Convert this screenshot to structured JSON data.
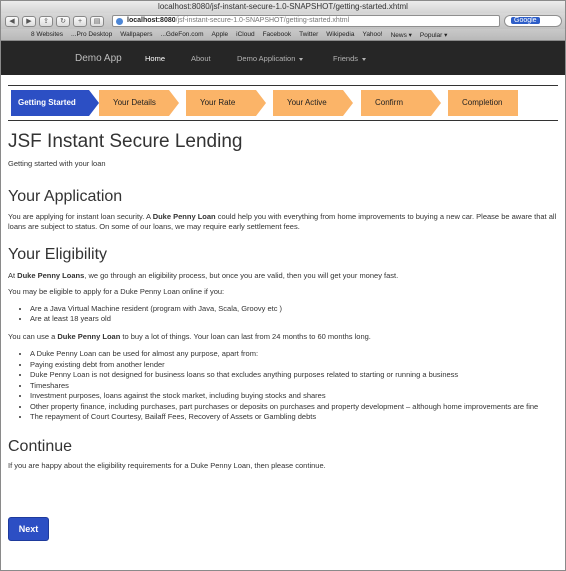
{
  "browser": {
    "title": "localhost:8080/jsf-instant-secure-1.0-SNAPSHOT/getting-started.xhtml",
    "url_host": "localhost:8080",
    "url_path": "/jsf-instant-secure-1.0-SNAPSHOT/getting-started.xhtml",
    "search_value": "Google",
    "bookmarks": [
      "8 Websites",
      "...Pro Desktop",
      "Wallpapers",
      "...GdeFon.com",
      "Apple",
      "iCloud",
      "Facebook",
      "Twitter",
      "Wikipedia",
      "Yahoo!",
      "News ▾",
      "Popular ▾"
    ]
  },
  "navbar": {
    "brand": "Demo App",
    "links": [
      "Home",
      "About",
      "Demo Application",
      "Friends"
    ]
  },
  "steps": [
    "Getting Started",
    "Your Details",
    "Your Rate",
    "Your Active",
    "Confirm",
    "Completion"
  ],
  "page": {
    "title": "JSF Instant Secure Lending",
    "subtitle": "Getting started with your loan",
    "application_heading": "Your Application",
    "application_p1": "You are applying for instant loan security. A ",
    "application_p1_bold": "Duke Penny Loan",
    "application_p1_rest": " could help you with everything from home improvements to buying a new car. Please be aware that all loans are subject to status. On some of our loans, we may require early settlement fees.",
    "eligibility_heading": "Your Eligibility",
    "elig_p1_pre": "At ",
    "elig_p1_bold": "Duke Penny Loans",
    "elig_p1_rest": ", we go through an eligibility process, but once you are valid, then you will get your money fast.",
    "elig_p2": "You may be eligible to apply for a Duke Penny Loan online if you:",
    "elig_list": [
      "Are a Java Virtual Machine resident (program with Java, Scala, Groovy etc )",
      "Are at least 18 years old"
    ],
    "elig_p3_pre": "You can use a ",
    "elig_p3_bold": "Duke Penny Loan",
    "elig_p3_rest": " to buy a lot of things. Your loan can last from 24 months to 60 months long.",
    "uses_list": [
      "A Duke Penny Loan can be used for almost any purpose, apart from:",
      "Paying existing debt from another lender",
      "Duke Penny Loan is not designed for business loans so that excludes anything purposes related to starting or running a business",
      "Timeshares",
      "Investment purposes, loans against the stock market, including buying stocks and shares",
      "Other property finance, including purchases, part purchases or deposits on purchases and property development – although home improvements are fine",
      "The repayment of Court Courtesy, Bailaff Fees, Recovery of Assets or Gambling debts"
    ],
    "continue_heading": "Continue",
    "continue_text": "If you are happy about the eligibility requirements for a Duke Penny Loan, then please continue.",
    "next_label": "Next"
  }
}
